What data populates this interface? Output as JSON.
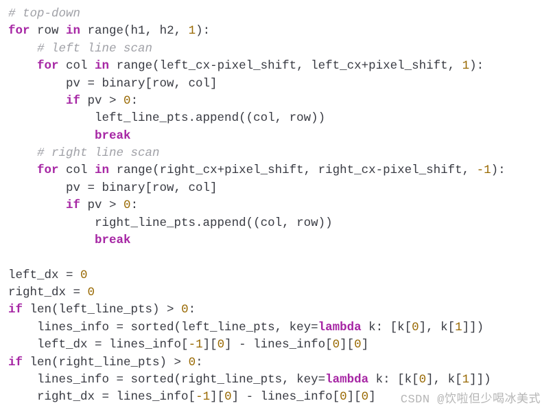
{
  "code": {
    "lines": [
      {
        "indent": 0,
        "tokens": [
          {
            "t": "# top-down",
            "c": "cm"
          }
        ]
      },
      {
        "indent": 0,
        "tokens": [
          {
            "t": "for",
            "c": "kw"
          },
          {
            "t": " row "
          },
          {
            "t": "in",
            "c": "kw"
          },
          {
            "t": " range(h1, h2, "
          },
          {
            "t": "1",
            "c": "num"
          },
          {
            "t": "):"
          }
        ]
      },
      {
        "indent": 1,
        "tokens": [
          {
            "t": "# left line scan",
            "c": "cm"
          }
        ]
      },
      {
        "indent": 1,
        "tokens": [
          {
            "t": "for",
            "c": "kw"
          },
          {
            "t": " col "
          },
          {
            "t": "in",
            "c": "kw"
          },
          {
            "t": " range(left_cx-pixel_shift, left_cx+pixel_shift, "
          },
          {
            "t": "1",
            "c": "num"
          },
          {
            "t": "):"
          }
        ]
      },
      {
        "indent": 2,
        "tokens": [
          {
            "t": "pv = binary[row, col]"
          }
        ]
      },
      {
        "indent": 2,
        "tokens": [
          {
            "t": "if",
            "c": "kw"
          },
          {
            "t": " pv > "
          },
          {
            "t": "0",
            "c": "num"
          },
          {
            "t": ":"
          }
        ]
      },
      {
        "indent": 3,
        "tokens": [
          {
            "t": "left_line_pts.append((col, row))"
          }
        ]
      },
      {
        "indent": 3,
        "tokens": [
          {
            "t": "break",
            "c": "kw"
          }
        ]
      },
      {
        "indent": 1,
        "tokens": [
          {
            "t": "# right line scan",
            "c": "cm"
          }
        ]
      },
      {
        "indent": 1,
        "tokens": [
          {
            "t": "for",
            "c": "kw"
          },
          {
            "t": " col "
          },
          {
            "t": "in",
            "c": "kw"
          },
          {
            "t": " range(right_cx+pixel_shift, right_cx-pixel_shift, "
          },
          {
            "t": "-1",
            "c": "num"
          },
          {
            "t": "):"
          }
        ]
      },
      {
        "indent": 2,
        "tokens": [
          {
            "t": "pv = binary[row, col]"
          }
        ]
      },
      {
        "indent": 2,
        "tokens": [
          {
            "t": "if",
            "c": "kw"
          },
          {
            "t": " pv > "
          },
          {
            "t": "0",
            "c": "num"
          },
          {
            "t": ":"
          }
        ]
      },
      {
        "indent": 3,
        "tokens": [
          {
            "t": "right_line_pts.append((col, row))"
          }
        ]
      },
      {
        "indent": 3,
        "tokens": [
          {
            "t": "break",
            "c": "kw"
          }
        ]
      },
      {
        "indent": 0,
        "tokens": [
          {
            "t": " "
          }
        ]
      },
      {
        "indent": 0,
        "tokens": [
          {
            "t": "left_dx = "
          },
          {
            "t": "0",
            "c": "num"
          }
        ]
      },
      {
        "indent": 0,
        "tokens": [
          {
            "t": "right_dx = "
          },
          {
            "t": "0",
            "c": "num"
          }
        ]
      },
      {
        "indent": 0,
        "tokens": [
          {
            "t": "if",
            "c": "kw"
          },
          {
            "t": " len(left_line_pts) > "
          },
          {
            "t": "0",
            "c": "num"
          },
          {
            "t": ":"
          }
        ]
      },
      {
        "indent": 1,
        "tokens": [
          {
            "t": "lines_info = sorted(left_line_pts, key="
          },
          {
            "t": "lambda",
            "c": "kw"
          },
          {
            "t": " k: [k["
          },
          {
            "t": "0",
            "c": "num"
          },
          {
            "t": "], k["
          },
          {
            "t": "1",
            "c": "num"
          },
          {
            "t": "]])"
          }
        ]
      },
      {
        "indent": 1,
        "tokens": [
          {
            "t": "left_dx = lines_info["
          },
          {
            "t": "-1",
            "c": "num"
          },
          {
            "t": "]["
          },
          {
            "t": "0",
            "c": "num"
          },
          {
            "t": "] - lines_info["
          },
          {
            "t": "0",
            "c": "num"
          },
          {
            "t": "]["
          },
          {
            "t": "0",
            "c": "num"
          },
          {
            "t": "]"
          }
        ]
      },
      {
        "indent": 0,
        "tokens": [
          {
            "t": "if",
            "c": "kw"
          },
          {
            "t": " len(right_line_pts) > "
          },
          {
            "t": "0",
            "c": "num"
          },
          {
            "t": ":"
          }
        ]
      },
      {
        "indent": 1,
        "tokens": [
          {
            "t": "lines_info = sorted(right_line_pts, key="
          },
          {
            "t": "lambda",
            "c": "kw"
          },
          {
            "t": " k: [k["
          },
          {
            "t": "0",
            "c": "num"
          },
          {
            "t": "], k["
          },
          {
            "t": "1",
            "c": "num"
          },
          {
            "t": "]])"
          }
        ]
      },
      {
        "indent": 1,
        "tokens": [
          {
            "t": "right_dx = lines_info["
          },
          {
            "t": "-1",
            "c": "num"
          },
          {
            "t": "]["
          },
          {
            "t": "0",
            "c": "num"
          },
          {
            "t": "] - lines_info["
          },
          {
            "t": "0",
            "c": "num"
          },
          {
            "t": "]["
          },
          {
            "t": "0",
            "c": "num"
          },
          {
            "t": "]"
          }
        ]
      }
    ]
  },
  "indent_unit": "    ",
  "watermark": "CSDN @饮啦但少喝冰美式"
}
